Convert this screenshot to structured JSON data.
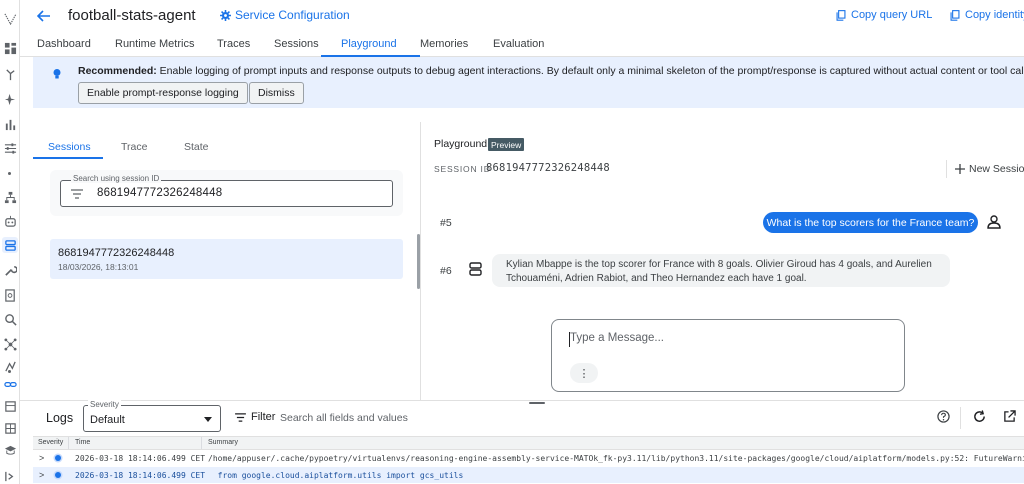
{
  "header": {
    "title": "football-stats-agent",
    "service_config": "Service Configuration",
    "copy_query_url": "Copy query URL",
    "copy_identity": "Copy identity"
  },
  "tabs": [
    "Dashboard",
    "Runtime Metrics",
    "Traces",
    "Sessions",
    "Playground",
    "Memories",
    "Evaluation"
  ],
  "active_tab": "Playground",
  "banner": {
    "bold": "Recommended:",
    "text": " Enable logging of prompt inputs and response outputs to debug agent interactions. By default only a minimal skeleton of the prompt/response is captured without actual content or tool call parameters.",
    "enable_button": "Enable prompt-response logging",
    "dismiss_button": "Dismiss"
  },
  "left_panel": {
    "tabs": [
      "Sessions",
      "Trace",
      "State"
    ],
    "search_label": "Search using session ID",
    "search_value": "8681947772326248448",
    "sessions": [
      {
        "id": "8681947772326248448",
        "datetime": "18/03/2026, 18:13:01"
      }
    ]
  },
  "playground": {
    "title": "Playground",
    "badge": "Preview",
    "session_label": "SESSION ID",
    "session_id": "8681947772326248448",
    "new_session": "New Session",
    "turns": [
      {
        "number": "#5",
        "role": "user",
        "text": "What is the top scorers for the France team?"
      },
      {
        "number": "#6",
        "role": "agent",
        "text": "Kylian Mbappe is the top scorer for France with 8 goals. Olivier Giroud has 4 goals, and Aurelien Tchouaméni, Adrien Rabiot, and Theo Hernandez each have 1 goal."
      }
    ],
    "composer_placeholder": "Type a Message...",
    "more_glyph": "⋮"
  },
  "logs": {
    "title": "Logs",
    "severity_label": "Severity",
    "severity_value": "Default",
    "filter_label": "Filter",
    "search_placeholder": "Search all fields and values",
    "columns": [
      "Severity",
      "Time",
      "Summary"
    ],
    "rows": [
      {
        "time": "2026-03-18 18:14:06.499 CET",
        "summary": "/home/appuser/.cache/pypoetry/virtualenvs/reasoning-engine-assembly-service-MATOk_fk-py3.11/lib/python3.11/site-packages/google/cloud/aiplatform/models.py:52: FutureWarning: Supp…"
      },
      {
        "time": "2026-03-18 18:14:06.499 CET",
        "summary": "  from google.cloud.aiplatform.utils import gcs_utils"
      }
    ]
  },
  "colors": {
    "accent": "#1a73e8",
    "banner_bg": "#e8f0fe",
    "user_bubble": "#1a73e8",
    "preview_badge": "#455a64"
  }
}
